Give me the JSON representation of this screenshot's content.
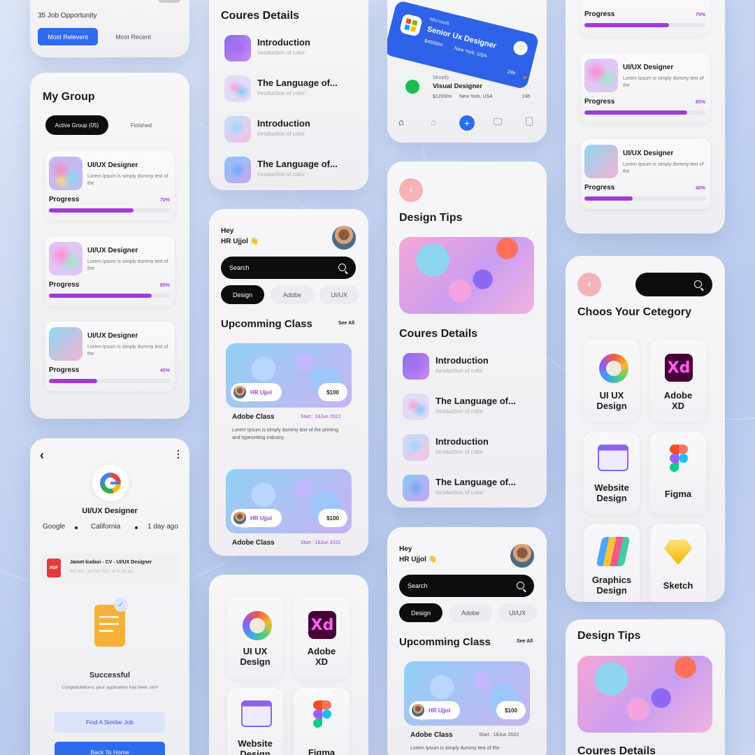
{
  "col1": {
    "jobs": {
      "count_label": "35 Job Opportunity",
      "tab_active": "Most Relevent",
      "tab_other": "Most Recent"
    },
    "group": {
      "title": "My Group",
      "tab_active": "Active Group (05)",
      "tab_other": "Finished",
      "items": [
        {
          "title": "UI/UX Designer",
          "desc": "Lorem Ipsum is simply dummy text of the",
          "progress_label": "Progress",
          "percent": "70%",
          "fill": 0.7
        },
        {
          "title": "UI/UX Designer",
          "desc": "Lorem Ipsum is simply dummy text of the",
          "progress_label": "Progress",
          "percent": "85%",
          "fill": 0.85
        },
        {
          "title": "UI/UX Designer",
          "desc": "Lorem Ipsum is simply dummy text of the",
          "progress_label": "Progress",
          "percent": "40%",
          "fill": 0.4
        }
      ]
    },
    "job": {
      "role": "UI/UX Designer",
      "company": "Google",
      "location": "California",
      "posted": "1 day ago",
      "file_name": "Jamet kudasi - CV - UI/UX Designer",
      "file_meta": "867 Kb · 14 Feb 2022 at 11:30 am",
      "file_type": "PDF",
      "status": "Successful",
      "message": "Congratulations, your application has been sent",
      "similar_button": "Find A Similar Job",
      "home_button": "Back To Home"
    }
  },
  "col2": {
    "course": {
      "title": "Coures Details",
      "items": [
        {
          "title": "Introduction",
          "sub": "Inroduction of color"
        },
        {
          "title": "The Language of...",
          "sub": "Inroduction of color"
        },
        {
          "title": "Introduction",
          "sub": "Inroduction of color"
        },
        {
          "title": "The Language of...",
          "sub": "Inroduction of color"
        }
      ]
    },
    "home": {
      "greeting": "Hey",
      "user": "HR Ujjol 👋",
      "search_placeholder": "Search",
      "tabs": [
        "Design",
        "Adobe",
        "UI/UX"
      ],
      "section": "Upcomming Class",
      "see_all": "See All",
      "classes": [
        {
          "host": "HR Ujjol",
          "price": "$100",
          "title": "Adobe Class",
          "start": "Start : 18Jun 2022",
          "desc": "Lorem Ipsum is simply dummy text of the printing and typesetting industry."
        },
        {
          "host": "HR Ujjol",
          "price": "$100",
          "title": "Adobe Class",
          "start": "Start : 18Jun 2022"
        }
      ]
    },
    "categories": [
      "UI UX Design",
      "Adobe XD",
      "Website Design",
      "Figma"
    ]
  },
  "col3": {
    "featured": {
      "company": "Microsoft",
      "title": "Senior Ux Designer",
      "salary": "$4500/m",
      "location": "New York, USA",
      "age": "24h"
    },
    "listing": {
      "company": "Shopify",
      "title": "Visual Designer",
      "salary": "$1200/m",
      "location": "New York, USA",
      "age": "24h"
    },
    "tips_title": "Design Tips",
    "course": {
      "title": "Coures Details",
      "items": [
        {
          "title": "Introduction",
          "sub": "Inroduction of color"
        },
        {
          "title": "The Language of...",
          "sub": "Inroduction of color"
        },
        {
          "title": "Introduction",
          "sub": "Inroduction of color"
        },
        {
          "title": "The Language of...",
          "sub": "Inroduction of color"
        }
      ]
    },
    "home": {
      "greeting": "Hey",
      "user": "HR Ujjol 👋",
      "search_placeholder": "Search",
      "tabs": [
        "Design",
        "Adobe",
        "UI/UX"
      ],
      "section": "Upcomming Class",
      "see_all": "See All",
      "class": {
        "host": "HR Ujjol",
        "price": "$100",
        "title": "Adobe Class",
        "start": "Start : 18Jun 2022",
        "desc": "Lorem Ipsum is simply dummy text of the"
      }
    }
  },
  "col4": {
    "progress_items": [
      {
        "progress_label": "Progress",
        "percent": "70%",
        "fill": 0.7
      },
      {
        "title": "UI/UX Designer",
        "desc": "Lorem Ipsum is simply dummy text of the",
        "progress_label": "Progress",
        "percent": "85%",
        "fill": 0.85
      },
      {
        "title": "UI/UX Designer",
        "desc": "Lorem Ipsum is simply dummy text of the",
        "progress_label": "Progress",
        "percent": "40%",
        "fill": 0.4
      }
    ],
    "category_title": "Choos Your Cetegory",
    "categories": [
      "UI UX Design",
      "Adobe XD",
      "Website Design",
      "Figma",
      "Graphics Design",
      "Sketch"
    ],
    "tips_title": "Design Tips",
    "course_title": "Coures Details"
  },
  "icons": {
    "xd": "Xd"
  },
  "colors": {
    "accent": "#a33ad6",
    "blue": "#2f6bf0",
    "dark": "#0d0d0d"
  }
}
